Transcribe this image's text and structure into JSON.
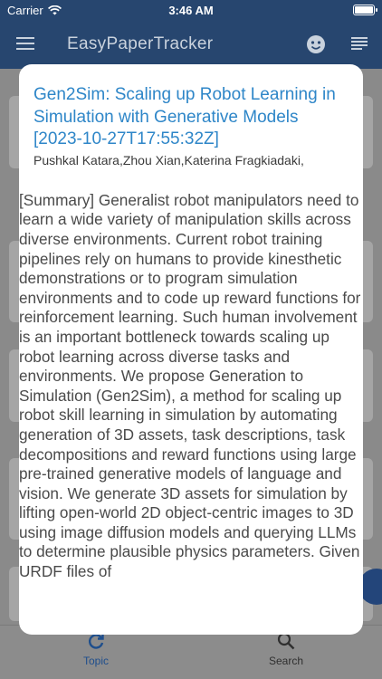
{
  "status_bar": {
    "carrier": "Carrier",
    "time": "3:46 AM"
  },
  "app_bar": {
    "title": "EasyPaperTracker",
    "icons": [
      "menu-icon",
      "face-icon",
      "list-icon"
    ]
  },
  "dialog": {
    "title": "Gen2Sim: Scaling up Robot Learning in Simulation with Generative Models [2023-10-27T17:55:32Z]",
    "authors": "Pushkal Katara,Zhou Xian,Katerina Fragkiadaki,",
    "summary": "[Summary]   Generalist robot manipulators need to learn a wide variety of manipulation skills across diverse environments. Current robot training pipelines rely on humans to provide kinesthetic demonstrations or to program simulation environments and to code up reward functions for reinforcement learning. Such human involvement is an important bottleneck towards scaling up robot learning across diverse tasks and environments. We propose Generation to Simulation (Gen2Sim), a method for scaling up robot skill learning in simulation by automating generation of 3D assets, task descriptions, task decompositions and reward functions using large pre-trained generative models of language and vision. We generate 3D assets for simulation by lifting open-world 2D object-centric images to 3D using image diffusion models and querying LLMs to determine plausible physics parameters. Given URDF files of"
  },
  "tab_bar": {
    "tabs": [
      {
        "label": "Topic",
        "icon": "refresh-icon",
        "active": true
      },
      {
        "label": "Search",
        "icon": "search-icon",
        "active": false
      }
    ]
  },
  "colors": {
    "app_bar": "#27466f",
    "title_link": "#2e86c8",
    "active_tab": "#1e4e8c"
  }
}
